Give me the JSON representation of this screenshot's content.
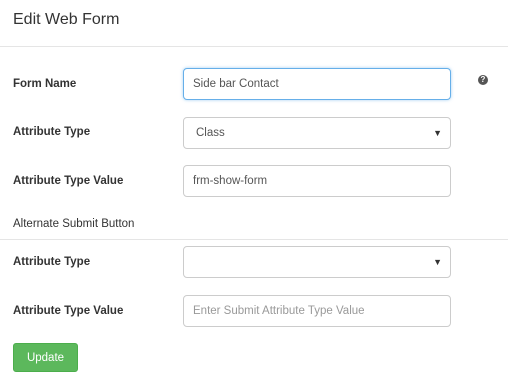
{
  "header": {
    "title": "Edit Web Form"
  },
  "form": {
    "form_name": {
      "label": "Form Name",
      "value": "Side bar Contact",
      "help_icon": "question-circle-icon"
    },
    "attribute_type": {
      "label": "Attribute Type",
      "selected": "Class"
    },
    "attribute_type_value": {
      "label": "Attribute Type Value",
      "value": "frm-show-form"
    },
    "section_label": "Alternate Submit Button",
    "submit_attribute_type": {
      "label": "Attribute Type",
      "selected": ""
    },
    "submit_attribute_type_value": {
      "label": "Attribute Type Value",
      "value": "",
      "placeholder": "Enter Submit Attribute Type Value"
    },
    "update_button": {
      "label": "Update",
      "color": "#5cb85c"
    }
  },
  "colors": {
    "focus_border": "#66afe9",
    "divider": "#e5e5e5"
  }
}
